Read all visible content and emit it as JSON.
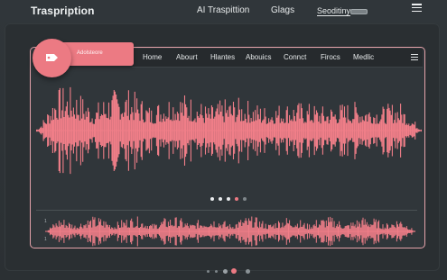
{
  "header": {
    "app_title": "Traspription",
    "links": [
      "AI Traspittion",
      "Glags",
      "Seoditiny"
    ]
  },
  "tab": {
    "label": "Adolsteore"
  },
  "nav": {
    "items": [
      "Home",
      "Abourt",
      "Hlantes",
      "Abouics",
      "Connct",
      "Firocs",
      "Medlic"
    ]
  },
  "carousel": {
    "dot_count": 5,
    "active_index": 3
  },
  "page_dots": {
    "dot_count": 5,
    "active_index": 3
  },
  "colors": {
    "accent": "#ec7a83",
    "waveform": "#f07e88",
    "card_border": "#e5a3ab",
    "background": "#2c3134"
  },
  "icons": {
    "top_menu": "hamburger-menu-icon",
    "nav_menu": "hamburger-menu-icon",
    "circle": "tag-icon"
  }
}
